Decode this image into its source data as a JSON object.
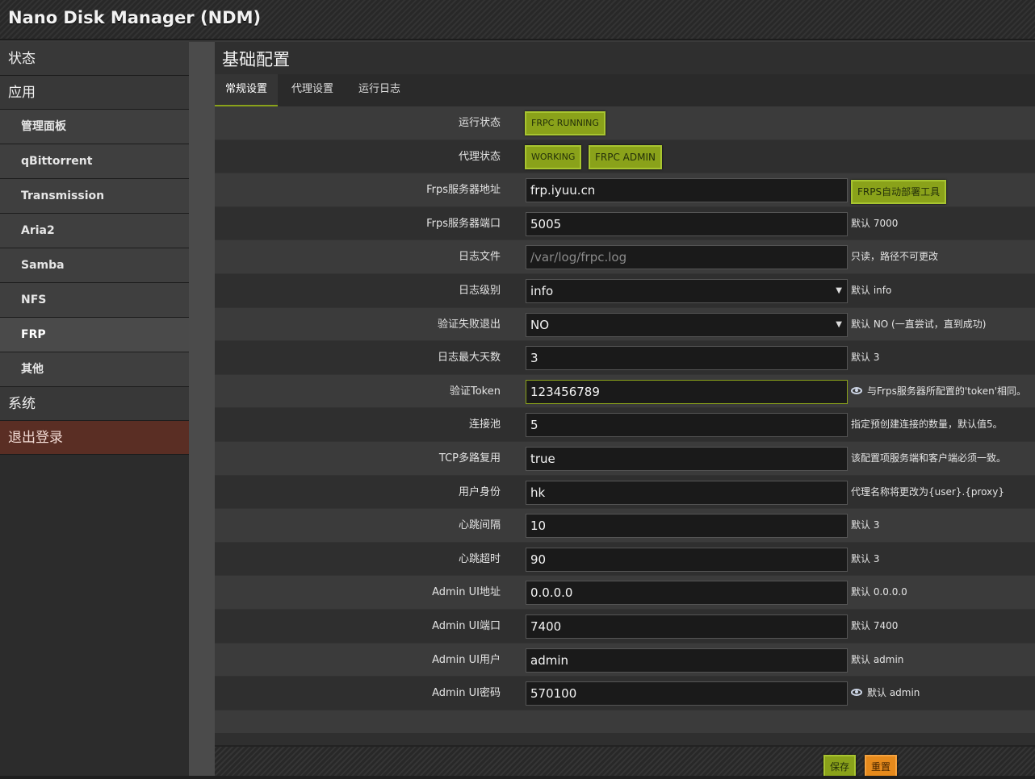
{
  "app": {
    "title": "Nano Disk Manager (NDM)"
  },
  "sidebar": {
    "items": [
      {
        "label": "状态",
        "level": "top"
      },
      {
        "label": "应用",
        "level": "top"
      },
      {
        "label": "管理面板",
        "level": "sub"
      },
      {
        "label": "qBittorrent",
        "level": "sub"
      },
      {
        "label": "Transmission",
        "level": "sub"
      },
      {
        "label": "Aria2",
        "level": "sub"
      },
      {
        "label": "Samba",
        "level": "sub"
      },
      {
        "label": "NFS",
        "level": "sub"
      },
      {
        "label": "FRP",
        "level": "sub",
        "active": true
      },
      {
        "label": "其他",
        "level": "sub"
      },
      {
        "label": "系统",
        "level": "top"
      },
      {
        "label": "退出登录",
        "level": "logout"
      }
    ]
  },
  "page": {
    "title": "基础配置"
  },
  "tabs": [
    {
      "label": "常规设置",
      "active": true
    },
    {
      "label": "代理设置"
    },
    {
      "label": "运行日志"
    }
  ],
  "form": {
    "run_status": {
      "label": "运行状态",
      "badge": "FRPC RUNNING"
    },
    "proxy_status": {
      "label": "代理状态",
      "badge": "WORKING",
      "admin_button": "FRPC ADMIN"
    },
    "server_addr": {
      "label": "Frps服务器地址",
      "value": "frp.iyuu.cn",
      "tool_button": "FRPS自动部署工具"
    },
    "server_port": {
      "label": "Frps服务器端口",
      "value": "5005",
      "hint": "默认 7000"
    },
    "log_file": {
      "label": "日志文件",
      "value": "/var/log/frpc.log",
      "hint": "只读，路径不可更改"
    },
    "log_level": {
      "label": "日志级别",
      "value": "info",
      "hint": "默认 info"
    },
    "exit_on_fail": {
      "label": "验证失败退出",
      "value": "NO",
      "hint": "默认 NO (一直尝试，直到成功)"
    },
    "log_max_days": {
      "label": "日志最大天数",
      "value": "3",
      "hint": "默认 3"
    },
    "token": {
      "label": "验证Token",
      "value": "123456789",
      "hint": "与Frps服务器所配置的'token'相同。"
    },
    "pool_count": {
      "label": "连接池",
      "value": "5",
      "hint": "指定预创建连接的数量，默认值5。"
    },
    "tcp_mux": {
      "label": "TCP多路复用",
      "value": "true",
      "hint": "该配置项服务端和客户端必须一致。"
    },
    "user": {
      "label": "用户身份",
      "value": "hk",
      "hint": "代理名称将更改为{user}.{proxy}"
    },
    "heartbeat_interval": {
      "label": "心跳间隔",
      "value": "10",
      "hint": "默认 3"
    },
    "heartbeat_timeout": {
      "label": "心跳超时",
      "value": "90",
      "hint": "默认 3"
    },
    "admin_addr": {
      "label": "Admin UI地址",
      "value": "0.0.0.0",
      "hint": "默认 0.0.0.0"
    },
    "admin_port": {
      "label": "Admin UI端口",
      "value": "7400",
      "hint": "默认 7400"
    },
    "admin_user": {
      "label": "Admin UI用户",
      "value": "admin",
      "hint": "默认 admin"
    },
    "admin_pwd": {
      "label": "Admin UI密码",
      "value": "570100",
      "hint": "默认 admin"
    }
  },
  "footer": {
    "save_label": "保存",
    "reset_label": "重置"
  },
  "colors": {
    "accent": "#8aa21a",
    "warn": "#e68a1c",
    "logout": "#5a2e24"
  }
}
